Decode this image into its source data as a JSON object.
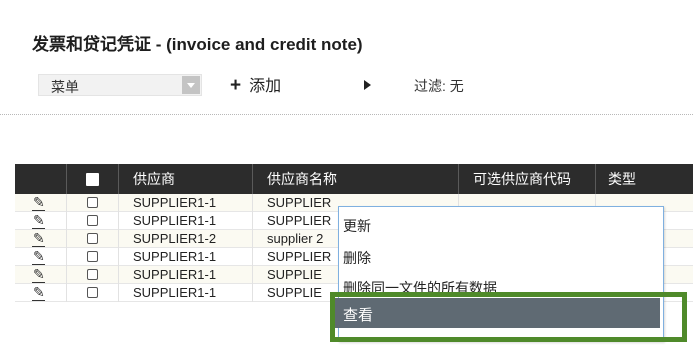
{
  "title": "发票和贷记凭证 - (invoice and credit note)",
  "toolbar": {
    "menu_label": "菜单",
    "add_label": "添加",
    "add_symbol": "+",
    "filter_label": "过滤: 无"
  },
  "table": {
    "headers": [
      "供应商",
      "供应商名称",
      "可选供应商代码",
      "类型"
    ],
    "rows": [
      {
        "supplier": "SUPPLIER1-1",
        "name": "SUPPLIER",
        "alt_code": "",
        "type": ""
      },
      {
        "supplier": "SUPPLIER1-1",
        "name": "SUPPLIER",
        "alt_code": "",
        "type": ""
      },
      {
        "supplier": "SUPPLIER1-2",
        "name": "supplier 2",
        "alt_code": "",
        "type": ""
      },
      {
        "supplier": "SUPPLIER1-1",
        "name": "SUPPLIER",
        "alt_code": "",
        "type": ""
      },
      {
        "supplier": "SUPPLIER1-1",
        "name": "SUPPLIE",
        "alt_code": "",
        "type": ""
      },
      {
        "supplier": "SUPPLIER1-1",
        "name": "SUPPLIE",
        "alt_code": "",
        "type": ""
      }
    ]
  },
  "context_menu": {
    "items": [
      "更新",
      "删除",
      "删除同一文件的所有数据",
      "查看"
    ]
  },
  "colors": {
    "header_bg": "#2c2c2c",
    "highlight_border": "#4f8a2a",
    "selected_item_bg": "#5f6a73",
    "menu_border": "#7fb0e0"
  },
  "icons": [
    "pencil-icon",
    "checkbox-icon",
    "dropdown-arrow-icon",
    "play-icon"
  ]
}
